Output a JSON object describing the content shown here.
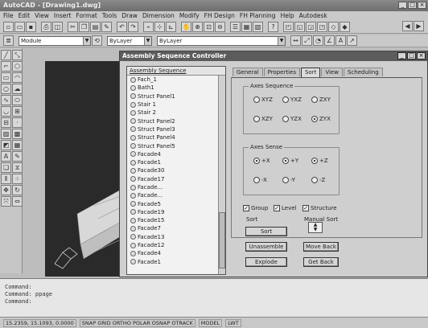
{
  "window": {
    "title": "AutoCAD - [Drawing1.dwg]",
    "minimize": "_",
    "maximize": "□",
    "close": "×"
  },
  "menu": [
    "File",
    "Edit",
    "View",
    "Insert",
    "Format",
    "Tools",
    "Draw",
    "Dimension",
    "Modify",
    "FH Design",
    "FH Planning",
    "Help",
    "Autodesk"
  ],
  "toolbar": {
    "combo_module": "Module",
    "combo_layer": "ByLayer",
    "combo_linetype": "ByLayer"
  },
  "dialog": {
    "title": "Assembly Sequence Controller",
    "tree_header": "Assembly Sequence",
    "tree_items": [
      "Fach_1",
      "Bath1",
      "Struct Panel1",
      "Stair 1",
      "Stair 2",
      "Struct Panel2",
      "Struct Panel3",
      "Struct Panel4",
      "Struct Panel5",
      "Facade4",
      "Facade1",
      "Facade30",
      "Facade17",
      "Facade...",
      "Facade...",
      "Facade5",
      "Facade19",
      "Facade15",
      "Facade7",
      "Facade13",
      "Facade12",
      "Facade4",
      "Facade1"
    ],
    "tabs": [
      "General",
      "Properties",
      "Sort",
      "View",
      "Scheduling"
    ],
    "active_tab": "Sort",
    "axis_sequence_label": "Axes Sequence",
    "axis_sequence_options": [
      "XYZ",
      "YXZ",
      "ZXY",
      "XZY",
      "YZX",
      "ZYX"
    ],
    "axis_sense_label": "Axes Sense",
    "axis_sense_options": [
      "+X",
      "+Y",
      "+Z",
      "-X",
      "-Y",
      "-Z"
    ],
    "checks": [
      "Group",
      "Level",
      "Structure"
    ],
    "sort_label": "Sort",
    "manual_sort_label": "Manual Sort",
    "buttons": {
      "sort": "Sort",
      "unassemble": "Unassemble",
      "explode": "Explode",
      "move_back": "Move Back",
      "get_back": "Get Back"
    }
  },
  "command": {
    "lines": [
      "Command:",
      "Command: ppage",
      "Command:"
    ]
  },
  "status": {
    "coords": "15.2359, 15.1093, 0.0000",
    "snap": "SNAP GRID ORTHO POLAR OSNAP OTRACK",
    "model": "MODEL",
    "lweight": "LWT"
  },
  "colors": {
    "dialog_title": "#5c5c5c",
    "viewport": "#2a2a2a"
  }
}
